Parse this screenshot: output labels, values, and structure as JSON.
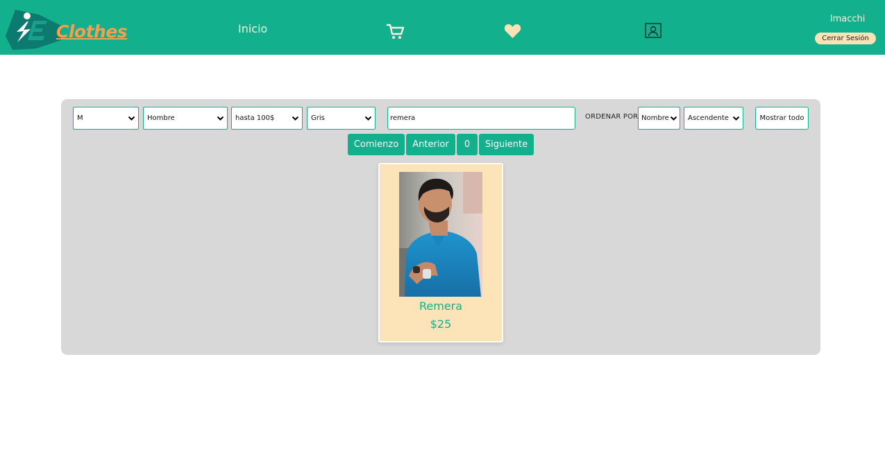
{
  "header": {
    "brand": "Clothes",
    "nav_home": "Inicio",
    "icons": [
      "cart-icon",
      "heart-icon",
      "profile-icon"
    ],
    "username": "lmacchi",
    "logout_label": "Cerrar Sesión"
  },
  "filters": {
    "size": "M",
    "gender": "Hombre",
    "price": "hasta 100$",
    "color": "Gris",
    "search_value": "remera",
    "order_label": "ORDENAR POR",
    "order_field": "Nombre",
    "order_direction": "Ascendente",
    "show_all_label": "Mostrar todo"
  },
  "pagination": {
    "first_label": "Comienzo",
    "prev_label": "Anterior",
    "page": "0",
    "next_label": "Siguiente"
  },
  "products": [
    {
      "name": "Remera",
      "price": "$25"
    }
  ],
  "colors": {
    "primary": "#12b08c",
    "accent": "#f4a04e",
    "card_bg": "#fde4b8",
    "panel_bg": "#d8d8d8",
    "nav_text": "#fdf1df"
  }
}
